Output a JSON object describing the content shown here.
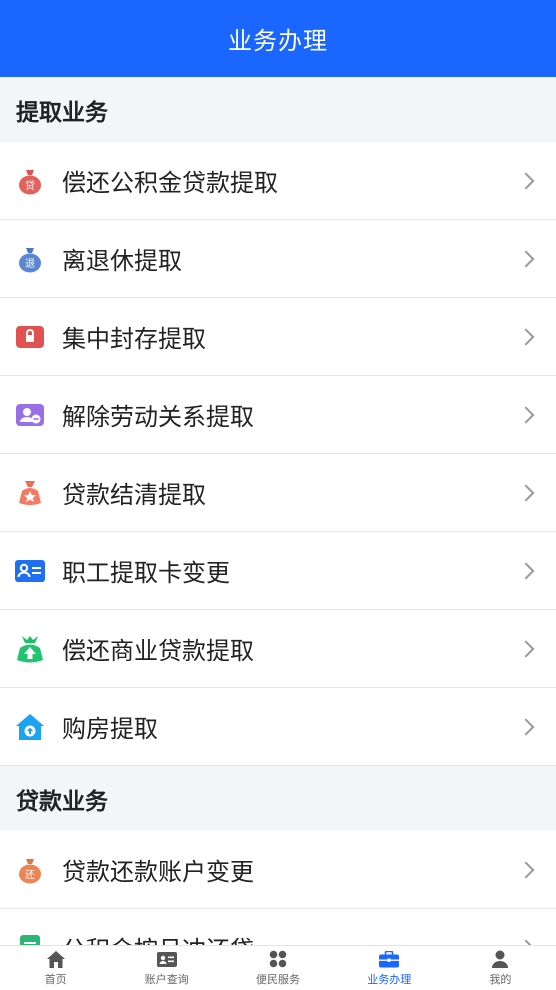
{
  "header": {
    "title": "业务办理"
  },
  "sections": [
    {
      "title": "提取业务",
      "items": [
        {
          "label": "偿还公积金贷款提取",
          "icon": "loan-bag-icon"
        },
        {
          "label": "离退休提取",
          "icon": "retire-bag-icon"
        },
        {
          "label": "集中封存提取",
          "icon": "lock-icon"
        },
        {
          "label": "解除劳动关系提取",
          "icon": "user-remove-icon"
        },
        {
          "label": "贷款结清提取",
          "icon": "star-bag-icon"
        },
        {
          "label": "职工提取卡变更",
          "icon": "id-card-icon"
        },
        {
          "label": "偿还商业贷款提取",
          "icon": "upload-bag-icon"
        },
        {
          "label": "购房提取",
          "icon": "house-icon"
        }
      ]
    },
    {
      "title": "贷款业务",
      "items": [
        {
          "label": "贷款还款账户变更",
          "icon": "repay-bag-icon"
        },
        {
          "label": "公积金按月冲还贷",
          "icon": "document-icon"
        }
      ]
    }
  ],
  "tabbar": [
    {
      "label": "首页",
      "icon": "home-icon"
    },
    {
      "label": "账户查询",
      "icon": "account-card-icon"
    },
    {
      "label": "便民服务",
      "icon": "grid-icon"
    },
    {
      "label": "业务办理",
      "icon": "briefcase-icon",
      "active": true
    },
    {
      "label": "我的",
      "icon": "person-icon"
    }
  ],
  "colors": {
    "primary": "#1a66ff"
  }
}
